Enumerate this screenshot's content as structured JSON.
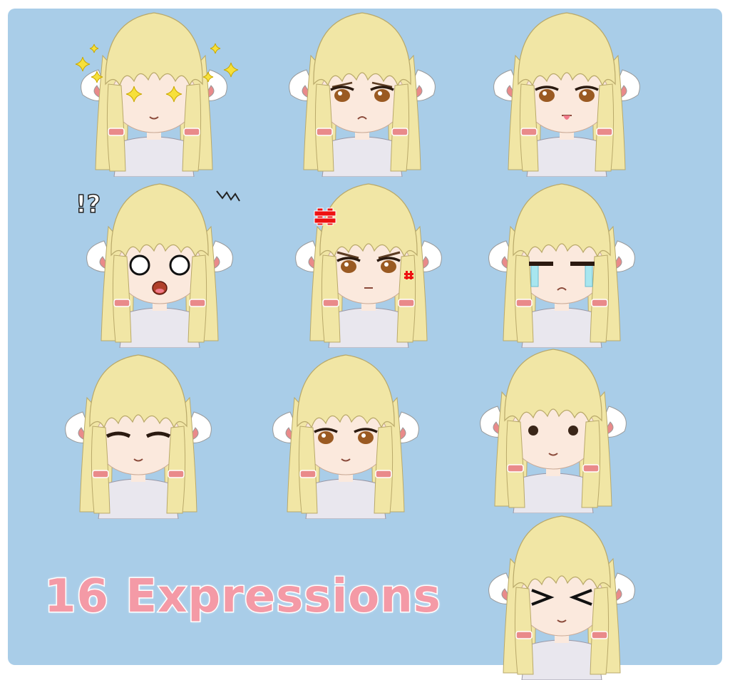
{
  "headline": "16 Expressions",
  "colors": {
    "background": "#a9cde8",
    "headline": "#f49aa6",
    "hair": "#f1e6a5",
    "skin": "#fbe9dd",
    "shirt": "#e9e7ee"
  },
  "expressions": [
    {
      "name": "sparkle-eyes-icon",
      "eyes": "sparkle",
      "mouth": "smile"
    },
    {
      "name": "sad-icon",
      "eyes": "brown-droopy",
      "mouth": "frown"
    },
    {
      "name": "tongue-out-icon",
      "eyes": "brown",
      "mouth": "tongue"
    },
    {
      "name": "surprised-icon",
      "eyes": "white-dots",
      "mouth": "open",
      "marks": "!?"
    },
    {
      "name": "angry-icon",
      "eyes": "brown-angry",
      "mouth": "flat"
    },
    {
      "name": "crying-icon",
      "eyes": "closed-tears",
      "mouth": "frown"
    },
    {
      "name": "closed-eyes-smile-icon",
      "eyes": "closed",
      "mouth": "smile"
    },
    {
      "name": "gentle-smile-icon",
      "eyes": "brown-soft",
      "mouth": "smile"
    },
    {
      "name": "dot-eyes-icon",
      "eyes": "dots",
      "mouth": "smile"
    },
    {
      "name": "squint-icon",
      "eyes": "squint",
      "mouth": "smile"
    }
  ]
}
